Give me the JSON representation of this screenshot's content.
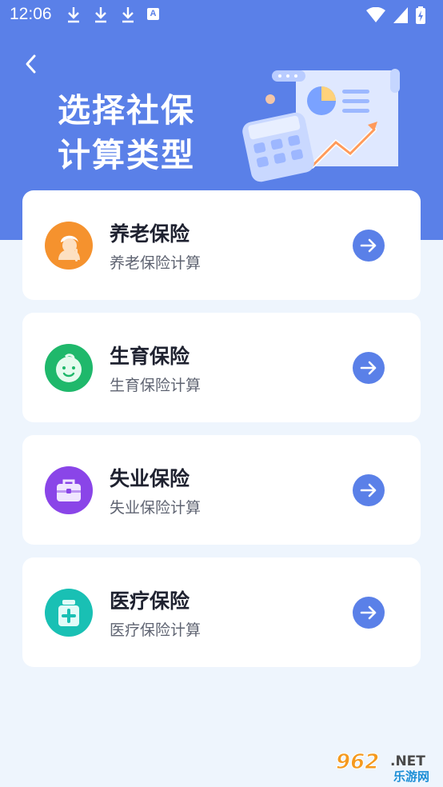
{
  "status": {
    "time": "12:06",
    "notif_letter": "A"
  },
  "header": {
    "title_line1": "选择社保",
    "title_line2": "计算类型"
  },
  "cards": [
    {
      "title": "养老保险",
      "subtitle": "养老保险计算",
      "color": "#f5922e",
      "icon": "elder-icon"
    },
    {
      "title": "生育保险",
      "subtitle": "生育保险计算",
      "color": "#1fb86b",
      "icon": "baby-face-icon"
    },
    {
      "title": "失业保险",
      "subtitle": "失业保险计算",
      "color": "#8a45e8",
      "icon": "briefcase-icon"
    },
    {
      "title": "医疗保险",
      "subtitle": "医疗保险计算",
      "color": "#19c0b4",
      "icon": "medicine-bottle-icon"
    }
  ],
  "watermark": {
    "brand": "962",
    "suffix": ".NET",
    "name": "乐游网"
  }
}
